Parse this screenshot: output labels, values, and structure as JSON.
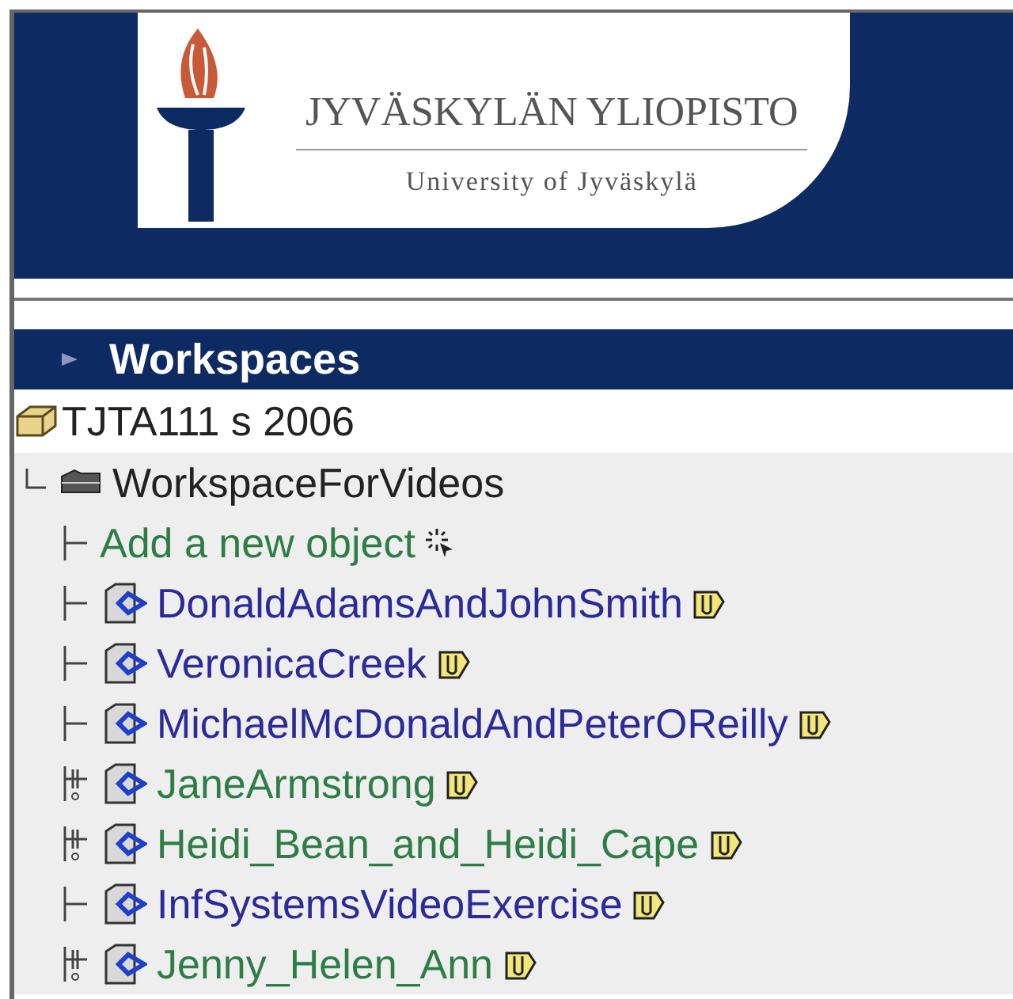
{
  "header": {
    "university_name": "JYVÄSKYLÄN YLIOPISTO",
    "university_name_en": "University of Jyväskylä"
  },
  "section": {
    "title": "Workspaces"
  },
  "tree": {
    "label": "TJTA111 s 2006",
    "children": [
      {
        "label": "WorkspaceForVideos",
        "add_link": "Add a new object",
        "children": [
          {
            "label": "DonaldAdamsAndJohnSmith",
            "flagged": false
          },
          {
            "label": "VeronicaCreek",
            "flagged": false
          },
          {
            "label": "MichaelMcDonaldAndPeterOReilly",
            "flagged": false
          },
          {
            "label": "JaneArmstrong",
            "flagged": true
          },
          {
            "label": "Heidi_Bean_and_Heidi_Cape",
            "flagged": true
          },
          {
            "label": "InfSystemsVideoExercise",
            "flagged": false
          },
          {
            "label": "Jenny_Helen_Ann",
            "flagged": true
          }
        ]
      }
    ]
  }
}
